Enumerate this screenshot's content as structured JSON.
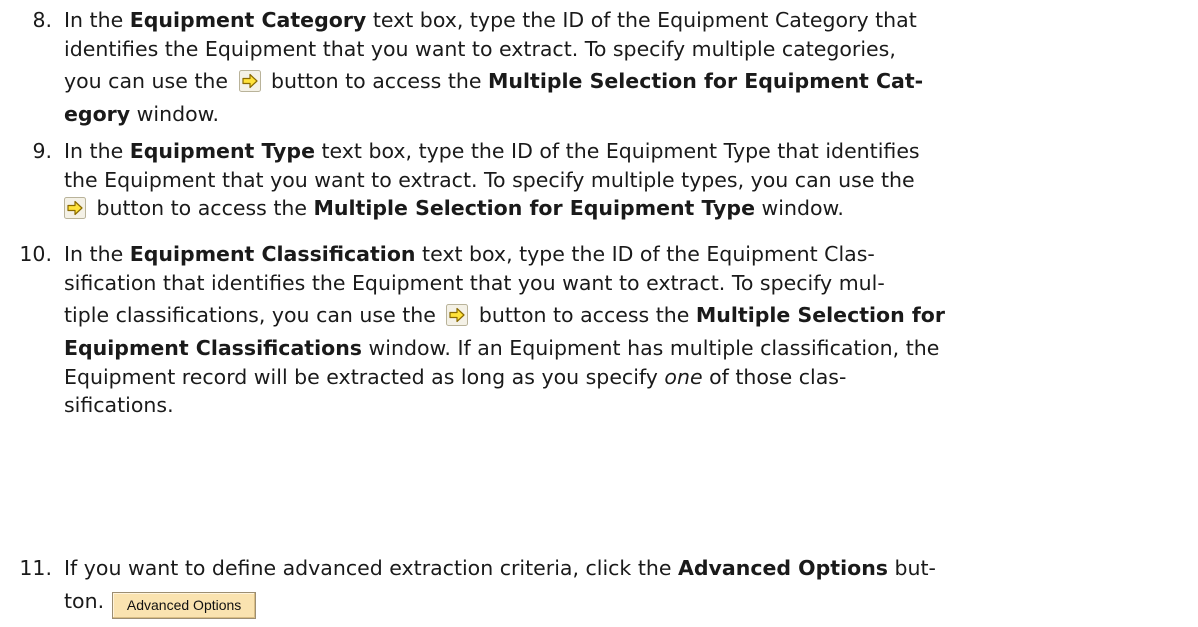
{
  "steps": [
    {
      "number": "8.",
      "lines": [
        [
          "In the ",
          "Equipment Category",
          " text box, type the ID of the Equipment Category that"
        ],
        [
          "identifies the Equipment that you want to extract. To specify multiple categories,"
        ],
        [
          "you can use the ",
          " button to access the ",
          "Multiple Selection for Equipment Cat-"
        ],
        [
          "egory",
          " window."
        ]
      ]
    },
    {
      "number": "9.",
      "lines": [
        [
          "In the ",
          "Equipment Type",
          " text box, type the ID of the Equipment Type that identifies"
        ],
        [
          "the Equipment that you want to extract. To specify multiple types, you can use the"
        ],
        [
          " button to access the ",
          "Multiple Selection for Equipment Type",
          " window."
        ]
      ]
    },
    {
      "number": "10.",
      "lines": [
        [
          "In the ",
          "Equipment Classification",
          " text box, type the ID of the Equipment Clas-"
        ],
        [
          "sification that identifies the Equipment that you want to extract. To specify mul-"
        ],
        [
          "tiple classifications, you can use the ",
          " button to access the ",
          "Multiple Selection for"
        ],
        [
          "Equipment Classifications",
          " window. If an Equipment has multiple classification, the"
        ],
        [
          "Equipment record will be extracted as long as you specify ",
          "one",
          " of those clas-"
        ],
        [
          "sifications."
        ]
      ]
    },
    {
      "number": "11.",
      "lines": [
        [
          "If you want to define advanced extraction criteria, click the ",
          "Advanced Options",
          " but-"
        ],
        [
          "ton."
        ]
      ]
    }
  ],
  "advanced_options_button_label": "Advanced Options",
  "selection_button_icon": "yellow-arrow-right-icon"
}
